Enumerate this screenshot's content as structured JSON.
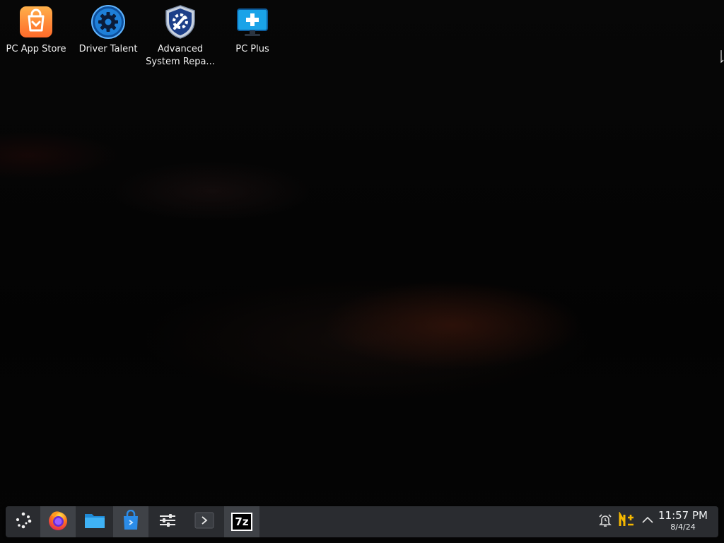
{
  "desktop": {
    "icons": [
      {
        "label": "PC App Store",
        "icon": "shopping-bag-icon"
      },
      {
        "label": "Driver Talent",
        "icon": "gear-icon"
      },
      {
        "label": "Advanced System Repa...",
        "icon": "shield-wrench-icon"
      },
      {
        "label": "PC Plus",
        "icon": "monitor-plus-icon"
      }
    ]
  },
  "taskbar": {
    "launchers": [
      {
        "icon": "application-launcher-icon"
      },
      {
        "icon": "firefox-icon",
        "active": true
      },
      {
        "icon": "file-manager-icon"
      },
      {
        "icon": "discover-store-icon",
        "active": true
      },
      {
        "icon": "system-settings-icon"
      },
      {
        "icon": "terminal-icon"
      },
      {
        "icon": "7zip-icon",
        "label": "7z"
      }
    ],
    "tray": [
      {
        "icon": "alarm-bell-icon"
      },
      {
        "icon": "mega-sync-icon"
      },
      {
        "icon": "chevron-up-icon"
      }
    ],
    "clock": {
      "time": "11:57 PM",
      "date": "8/4/24"
    }
  },
  "colors": {
    "taskbar_bg": "#2a2c30",
    "app_store_orange": "#ff8a3d",
    "driver_talent_blue": "#1e7fd8",
    "pc_plus_blue": "#1aa3e8",
    "tray_accent": "#f5b800"
  }
}
